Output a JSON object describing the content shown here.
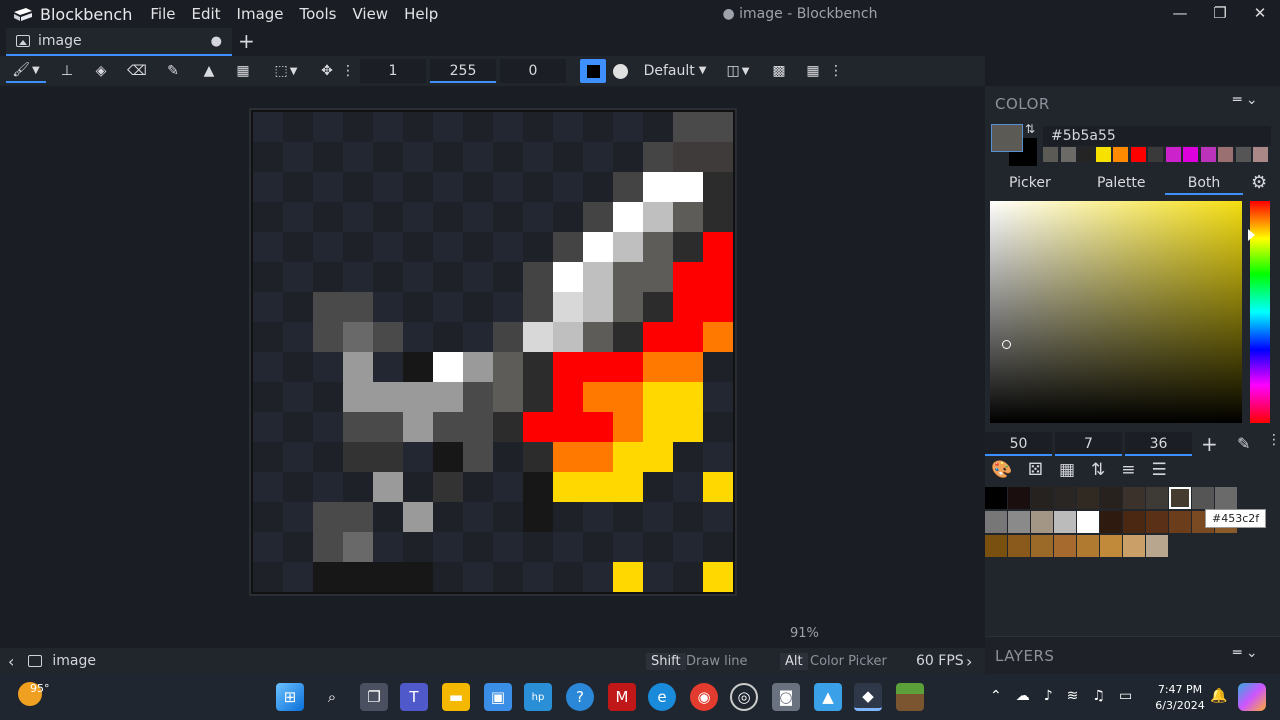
{
  "app": {
    "name": "Blockbench",
    "window_title": "● image - Blockbench"
  },
  "menu": [
    "File",
    "Edit",
    "Image",
    "Tools",
    "View",
    "Help"
  ],
  "tab": {
    "label": "image",
    "modified": "●",
    "new_tab": "+"
  },
  "toolbar": {
    "brush_size": "1",
    "opacity": "255",
    "softness": "0",
    "blend_mode": "Default"
  },
  "canvas": {
    "zoom": "91%",
    "pixels": [
      "................#99.",
      "...............622k",
      "..............dk0zj",
      ".............ckyqg.",
      "............5kupkRR",
      "...........xkvzpfRR",
      "..33.......zwvpaRRO",
      "..3b4.....yzwpRRRRO",
      "...bbx....mLxfRROOYY",
      "...o8kf..kw4pRRROOYY",
      "...4h9ssn4q3RROOOYYY",
      "....fsstt.h.RRROOYY",
      "....d9.3ll.aO.YY...",
      "...5b.b..vv.lYYY..Y",
      "..77q.ff....OO.....",
      "...ll.5.......Y..Y.",
      ".....................",
      "..........................."
    ]
  },
  "statusbar": {
    "file": "image",
    "hint1_key": "Shift",
    "hint1": "Draw line",
    "hint2_key": "Alt",
    "hint2": "Color Picker",
    "fps": "60 FPS"
  },
  "color_panel": {
    "title": "COLOR",
    "hex": "#5b5a55",
    "current": "#5b5a55",
    "secondary": "#000000",
    "tabs": [
      "Picker",
      "Palette",
      "Both"
    ],
    "active_tab": "Both",
    "values": [
      "50",
      "7",
      "36"
    ],
    "recent": [
      "#5b5a55",
      "#6b6a66",
      "#242424",
      "#f7e100",
      "#ff8a00",
      "#ff0000",
      "#3a3a3a",
      "#cc22cc",
      "#dd00dd",
      "#bb33bb",
      "#9a7070",
      "#555555",
      "#aa8888"
    ],
    "tooltip": "#453c2f",
    "palette_row1": [
      "#000000",
      "#1a0e0e",
      "#262220",
      "#2a2624",
      "#302a22",
      "#27221e",
      "#3a322b",
      "#3e3a36",
      "#453c2f",
      "#555555",
      "#6a6a6a"
    ],
    "palette_row2": [
      "#777777",
      "#8a8a8a",
      "#a39684",
      "#bbbbbb",
      "#ffffff",
      "#2e1a0f",
      "#4a2812",
      "#5a3016",
      "#6b3d1a",
      "#7a4a22",
      "#8b5a2b"
    ],
    "palette_row3": [
      "#7a5010",
      "#8a5a1c",
      "#9c6a28",
      "#a66a2e",
      "#b07a30",
      "#c08a3a",
      "#caa068",
      "#b8a68e"
    ]
  },
  "layers_panel": {
    "title": "LAYERS"
  },
  "taskbar": {
    "weather": "95°",
    "time": "7:47 PM",
    "date": "6/3/2024"
  },
  "colors": {
    "accent": "#3e90ff",
    "red": "#ff0000",
    "orange": "#ff7a00",
    "yellow": "#ffd900"
  }
}
